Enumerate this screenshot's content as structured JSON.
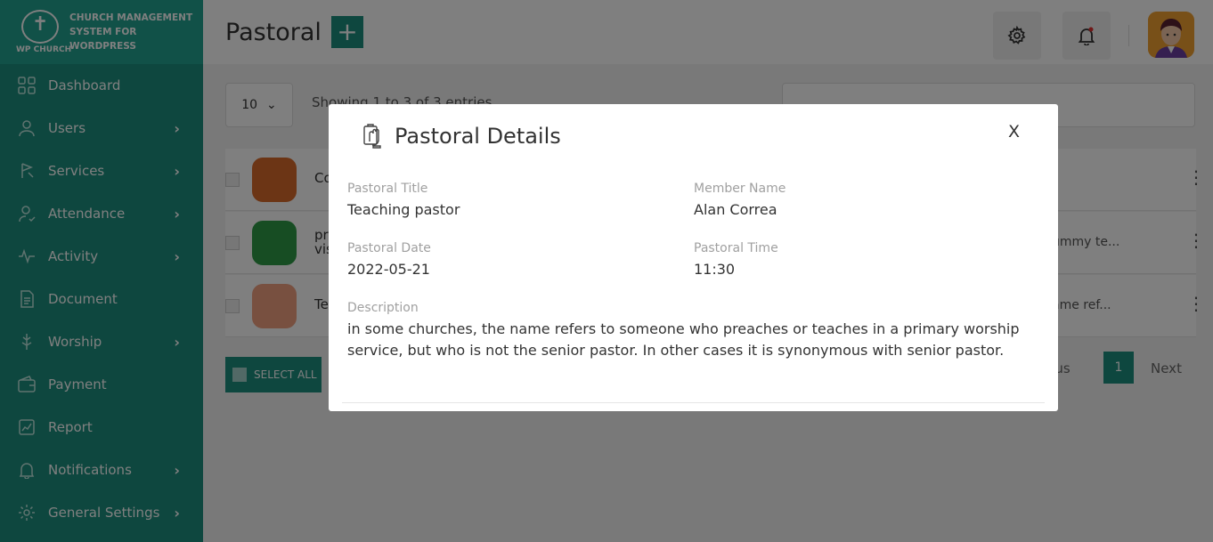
{
  "brand": {
    "logo_text": "WP CHURCH",
    "tagline": "CHURCH MANAGEMENT SYSTEM FOR WORDPRESS"
  },
  "sidebar": {
    "items": [
      {
        "label": "Dashboard",
        "icon": "dashboard-icon",
        "has_submenu": false
      },
      {
        "label": "Users",
        "icon": "user-icon",
        "has_submenu": true
      },
      {
        "label": "Services",
        "icon": "services-icon",
        "has_submenu": true
      },
      {
        "label": "Attendance",
        "icon": "attendance-icon",
        "has_submenu": true
      },
      {
        "label": "Activity",
        "icon": "activity-icon",
        "has_submenu": true
      },
      {
        "label": "Document",
        "icon": "document-icon",
        "has_submenu": false
      },
      {
        "label": "Worship",
        "icon": "worship-icon",
        "has_submenu": true
      },
      {
        "label": "Payment",
        "icon": "payment-icon",
        "has_submenu": false
      },
      {
        "label": "Report",
        "icon": "report-icon",
        "has_submenu": false
      },
      {
        "label": "Notifications",
        "icon": "bell-icon",
        "has_submenu": true
      },
      {
        "label": "General Settings",
        "icon": "gear-icon",
        "has_submenu": true
      }
    ]
  },
  "header": {
    "title": "Pastoral",
    "add_label": "+"
  },
  "table": {
    "page_length": "10",
    "entries_info": "Showing 1 to 3 of 3 entries",
    "rows": [
      {
        "name": "Co",
        "desc": "",
        "thumb_color": "#d96a2b"
      },
      {
        "name": "pr\nvis",
        "desc": "ummy te...",
        "thumb_color": "#2e9a46"
      },
      {
        "name": "Te",
        "desc": "ame ref...",
        "thumb_color": "#f0a080"
      }
    ],
    "select_all_label": "SELECT ALL",
    "pager": {
      "prev": "ious",
      "page": "1",
      "next": "Next"
    }
  },
  "modal": {
    "title": "Pastoral Details",
    "close_label": "X",
    "fields": {
      "pastoral_title_label": "Pastoral Title",
      "pastoral_title_value": "Teaching pastor",
      "member_name_label": "Member Name",
      "member_name_value": "Alan Correa",
      "pastoral_date_label": "Pastoral Date",
      "pastoral_date_value": "2022-05-21",
      "pastoral_time_label": "Pastoral Time",
      "pastoral_time_value": "11:30",
      "description_label": "Description",
      "description_value": "in some churches, the name refers to someone who preaches or teaches in a primary worship service, but who is not the senior pastor. In other cases it is synonymous with senior pastor."
    }
  },
  "colors": {
    "brand": "#1d8f7f",
    "brand_light": "#22a291",
    "overlay": "rgba(0,0,0,0.5)"
  }
}
